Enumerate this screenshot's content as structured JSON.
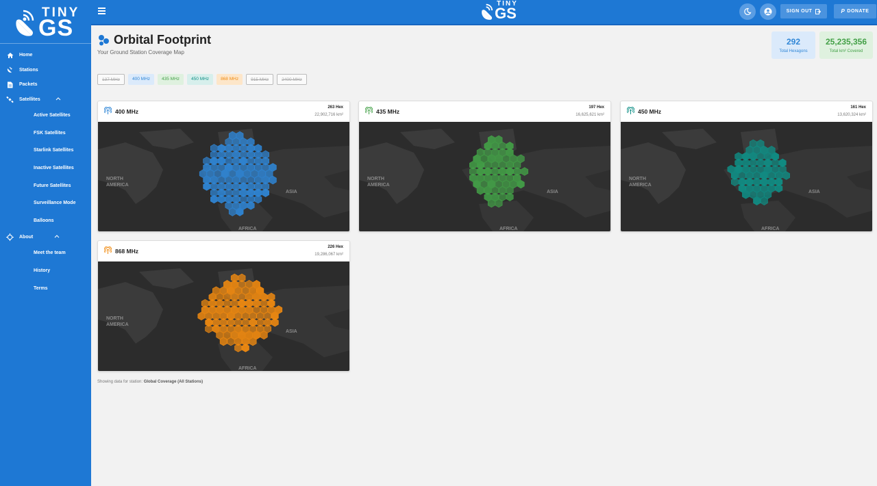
{
  "app": {
    "logo_small": "TINY",
    "logo_big": "GS"
  },
  "sidebar": {
    "items": [
      {
        "label": "Home",
        "icon": "home-icon"
      },
      {
        "label": "Stations",
        "icon": "satellite-dish-icon"
      },
      {
        "label": "Packets",
        "icon": "document-icon"
      },
      {
        "label": "Satellites",
        "icon": "satellite-icon"
      }
    ],
    "satellites_sub": [
      "Active Satellites",
      "FSK Satellites",
      "Starlink Satellites",
      "Inactive Satellites",
      "Future Satellites",
      "Surveillance Mode",
      "Balloons"
    ],
    "about": {
      "label": "About",
      "icon": "crosshair-icon"
    },
    "about_sub": [
      "Meet the team",
      "History",
      "Terms"
    ]
  },
  "topbar": {
    "sign_out": "SIGN OUT",
    "donate": "DONATE"
  },
  "header": {
    "title": "Orbital Footprint",
    "subtitle": "Your Ground Station Coverage Map"
  },
  "stats": {
    "hexagons_value": "292",
    "hexagons_label": "Total Hexagons",
    "km_value": "25,235,356",
    "km_label": "Total km² Covered"
  },
  "chips": [
    {
      "label": "137 MHz",
      "active": false
    },
    {
      "label": "400 MHz",
      "active": true,
      "color": "#2f86d6",
      "bg": "#dbeafb"
    },
    {
      "label": "435 MHz",
      "active": true,
      "color": "#43a047",
      "bg": "#dff1df"
    },
    {
      "label": "450 MHz",
      "active": true,
      "color": "#0f8f86",
      "bg": "#d7efec"
    },
    {
      "label": "868 MHz",
      "active": true,
      "color": "#f08a10",
      "bg": "#fde6c9"
    },
    {
      "label": "915 MHz",
      "active": false
    },
    {
      "label": "2400 MHz",
      "active": false
    }
  ],
  "cards": [
    {
      "title": "400 MHz",
      "hex": "263 Hex",
      "km": "22,902,716 km²",
      "color": "#2f86d6"
    },
    {
      "title": "435 MHz",
      "hex": "197 Hex",
      "km": "16,625,621 km²",
      "color": "#43a047"
    },
    {
      "title": "450 MHz",
      "hex": "161 Hex",
      "km": "13,620,324 km²",
      "color": "#0f8f86"
    },
    {
      "title": "868 MHz",
      "hex": "226 Hex",
      "km": "19,286,067 km²",
      "color": "#f08a10"
    }
  ],
  "map_labels": {
    "north_america_1": "NORTH",
    "north_america_2": "AMERICA",
    "asia": "ASIA",
    "africa": "AFRICA"
  },
  "footer": {
    "prefix": "Showing data for station:",
    "station": "Global Coverage (All Stations)"
  }
}
